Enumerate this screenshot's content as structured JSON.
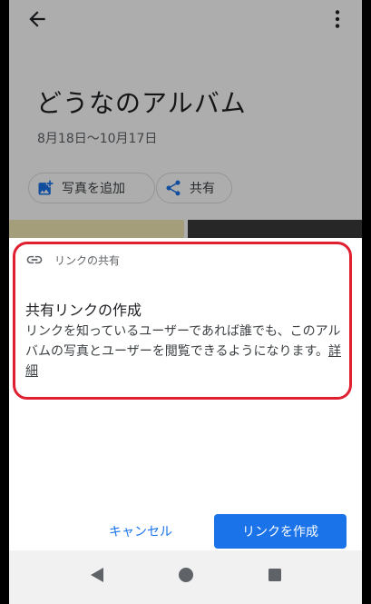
{
  "album": {
    "title": "どうなのアルバム",
    "date_range": "8月18日〜10月17日",
    "add_photos_label": "写真を追加",
    "share_label": "共有"
  },
  "sheet": {
    "header_label": "リンクの共有",
    "title": "共有リンクの作成",
    "description": "リンクを知っているユーザーであれば誰でも、このアルバムの写真とユーザーを閲覧できるようになります。",
    "details_link": "詳細",
    "cancel_label": "キャンセル",
    "create_label": "リンクを作成"
  },
  "colors": {
    "accent": "#1a73e8",
    "highlight": "#e02030"
  },
  "icons": [
    "back-arrow-icon",
    "more-vert-icon",
    "add-photo-icon",
    "share-icon",
    "link-icon",
    "nav-back-icon",
    "nav-home-icon",
    "nav-recents-icon"
  ]
}
